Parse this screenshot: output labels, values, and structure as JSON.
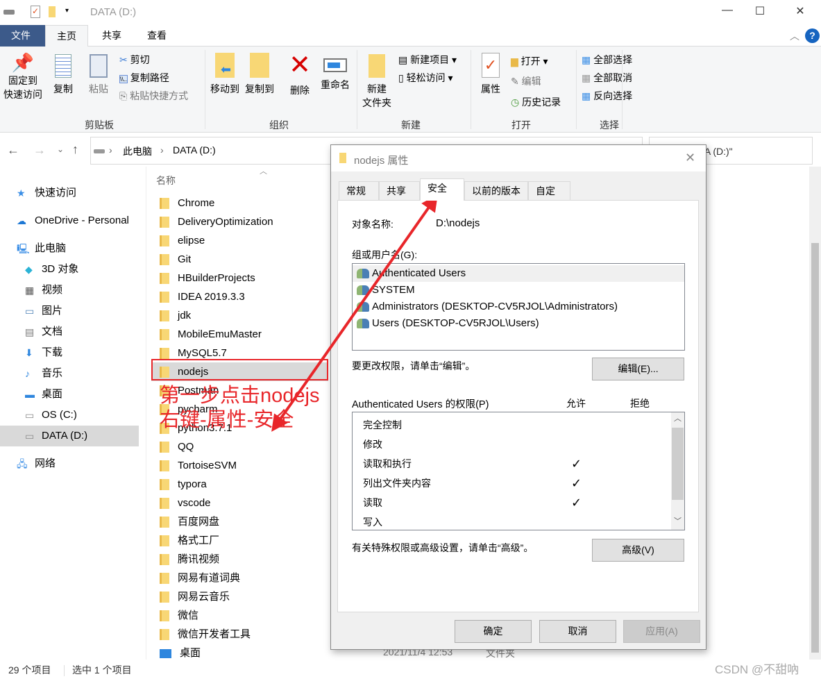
{
  "window": {
    "title": "DATA (D:)",
    "minimize": "—",
    "maximize": "☐",
    "close": "✕"
  },
  "menu": {
    "file": "文件",
    "tabs": [
      "主页",
      "共享",
      "查看"
    ],
    "help": "?"
  },
  "ribbon": {
    "clipboard": {
      "pin": "固定到\n快速访问",
      "copy": "复制",
      "paste": "粘贴",
      "cut": "剪切",
      "copy_path": "复制路径",
      "paste_shortcut": "粘贴快捷方式",
      "group": "剪贴板"
    },
    "organize": {
      "move_to": "移动到",
      "copy_to": "复制到",
      "delete": "删除",
      "rename": "重命名",
      "group": "组织"
    },
    "new": {
      "new_folder": "新建\n文件夹",
      "new_item": "新建项目",
      "easy_access": "轻松访问",
      "group": "新建"
    },
    "open": {
      "properties": "属性",
      "open": "打开",
      "edit": "编辑",
      "history": "历史记录",
      "group": "打开"
    },
    "select": {
      "select_all": "全部选择",
      "select_none": "全部取消",
      "invert": "反向选择",
      "group": "选择"
    }
  },
  "address": {
    "segments": [
      "此电脑",
      "DATA (D:)"
    ],
    "search_placeholder": "搜索\"DATA (D:)\""
  },
  "sidebar": {
    "items": [
      {
        "label": "快速访问",
        "icon": "star-icon"
      },
      {
        "label": "OneDrive - Personal",
        "icon": "cloud-icon"
      },
      {
        "label": "此电脑",
        "icon": "computer-icon"
      },
      {
        "label": "3D 对象",
        "icon": "cube-icon"
      },
      {
        "label": "视频",
        "icon": "video-icon"
      },
      {
        "label": "图片",
        "icon": "picture-icon"
      },
      {
        "label": "文档",
        "icon": "document-icon"
      },
      {
        "label": "下载",
        "icon": "download-icon"
      },
      {
        "label": "音乐",
        "icon": "music-icon"
      },
      {
        "label": "桌面",
        "icon": "desktop-icon"
      },
      {
        "label": "OS (C:)",
        "icon": "drive-icon"
      },
      {
        "label": "DATA (D:)",
        "icon": "drive-icon",
        "selected": true
      },
      {
        "label": "网络",
        "icon": "network-icon"
      }
    ]
  },
  "files": {
    "column_name": "名称",
    "items": [
      "Chrome",
      "DeliveryOptimization",
      "elipse",
      "Git",
      "HBuilderProjects",
      "IDEA 2019.3.3",
      "jdk",
      "MobileEmuMaster",
      "MySQL5.7",
      "nodejs",
      "Postman",
      "pycharm",
      "python3.7.1",
      "QQ",
      "TortoiseSVM",
      "typora",
      "vscode",
      "百度网盘",
      "格式工厂",
      "腾讯视频",
      "网易有道词典",
      "网易云音乐",
      "微信",
      "微信开发者工具",
      "桌面"
    ],
    "selected": "nodejs",
    "last_date": "2021/11/4 12:53",
    "last_type": "文件夹"
  },
  "status": {
    "count": "29 个项目",
    "selected": "选中 1 个项目"
  },
  "dialog": {
    "title": "nodejs 属性",
    "tabs": [
      "常规",
      "共享",
      "安全",
      "以前的版本",
      "自定义"
    ],
    "active_tab": "安全",
    "object_label": "对象名称:",
    "object_value": "D:\\nodejs",
    "groups_label": "组或用户名(G):",
    "users": [
      "Authenticated Users",
      "SYSTEM",
      "Administrators (DESKTOP-CV5RJOL\\Administrators)",
      "Users (DESKTOP-CV5RJOL\\Users)"
    ],
    "edit_hint": "要更改权限，请单击“编辑”。",
    "edit_button": "编辑(E)...",
    "perm_label": "Authenticated Users 的权限(P)",
    "allow": "允许",
    "deny": "拒绝",
    "permissions": [
      {
        "name": "完全控制",
        "allow": false
      },
      {
        "name": "修改",
        "allow": false
      },
      {
        "name": "读取和执行",
        "allow": true
      },
      {
        "name": "列出文件夹内容",
        "allow": true
      },
      {
        "name": "读取",
        "allow": true
      },
      {
        "name": "写入",
        "allow": false
      }
    ],
    "advanced_hint": "有关特殊权限或高级设置，请单击“高级”。",
    "advanced_button": "高级(V)",
    "ok": "确定",
    "cancel": "取消",
    "apply": "应用(A)"
  },
  "annotation": {
    "line1": "第一步点击nodejs",
    "line2": "右键-属性-安全",
    "color": "#e8262a"
  },
  "watermark": "CSDN @不甜吶"
}
